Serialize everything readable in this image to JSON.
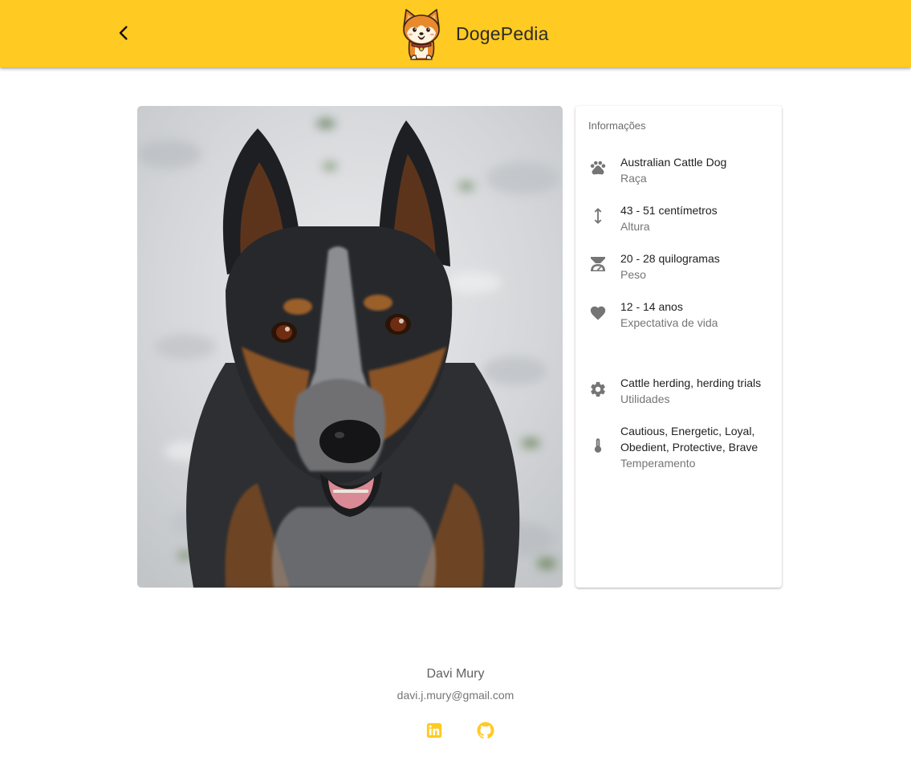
{
  "app": {
    "title": "DogePedia",
    "accent_color": "#ffca22",
    "back_icon": "arrow-back-icon",
    "logo_icon": "shiba-dog-logo"
  },
  "breed_image": {
    "subject": "australian-cattle-dog-photo"
  },
  "info": {
    "heading": "Informações",
    "items": [
      {
        "icon": "paw-icon",
        "value": "Australian Cattle Dog",
        "label": "Raça"
      },
      {
        "icon": "height-icon",
        "value": "43 - 51 centímetros",
        "label": "Altura"
      },
      {
        "icon": "scale-icon",
        "value": "20 - 28 quilogramas",
        "label": "Peso"
      },
      {
        "icon": "heart-icon",
        "value": "12 - 14 anos",
        "label": "Expectativa de vida"
      },
      {
        "icon": "gear-icon",
        "value": "Cattle herding, herding trials",
        "label": "Utilidades"
      },
      {
        "icon": "thermometer-icon",
        "value": "Cautious, Energetic, Loyal, Obedient, Protective, Brave",
        "label": "Temperamento"
      }
    ]
  },
  "footer": {
    "name": "Davi Mury",
    "email": "davi.j.mury@gmail.com",
    "links": [
      {
        "icon": "linkedin-icon"
      },
      {
        "icon": "github-icon"
      }
    ]
  }
}
